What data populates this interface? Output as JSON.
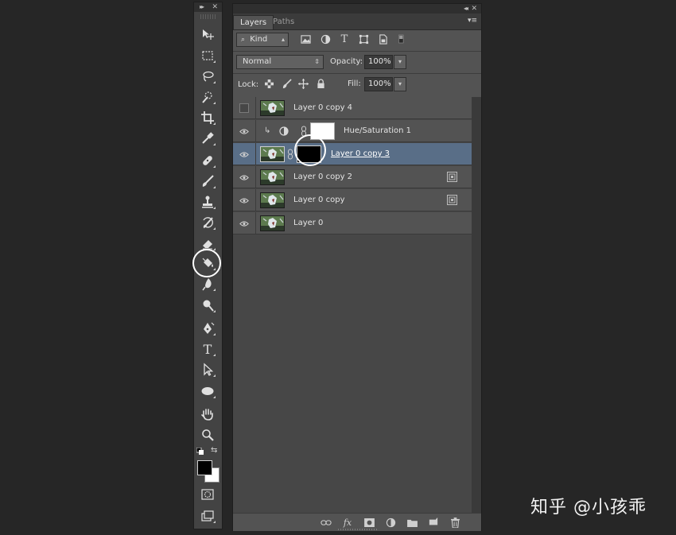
{
  "layers_panel": {
    "tabs": [
      {
        "label": "Layers"
      },
      {
        "label": "Paths"
      }
    ],
    "filter": {
      "kind_label": "Kind"
    },
    "blend_mode": "Normal",
    "opacity_label": "Opacity:",
    "opacity_value": "100%",
    "lock_label": "Lock:",
    "fill_label": "Fill:",
    "fill_value": "100%",
    "layers": [
      {
        "name": "Layer 0 copy 4",
        "visible": false,
        "selected": false
      },
      {
        "name": "Hue/Saturation 1",
        "visible": true,
        "selected": false,
        "adjustment": true,
        "clipped": true,
        "mask_color": "#ffffff"
      },
      {
        "name": "Layer 0 copy 3",
        "visible": true,
        "selected": true,
        "mask_color": "#000000"
      },
      {
        "name": "Layer 0 copy 2",
        "visible": true,
        "selected": false,
        "smart_object": true
      },
      {
        "name": "Layer 0 copy",
        "visible": true,
        "selected": false,
        "smart_object": true
      },
      {
        "name": "Layer 0",
        "visible": true,
        "selected": false
      }
    ],
    "bottom_icons": [
      "link-icon",
      "fx-icon",
      "add-mask-icon",
      "adjustment-icon",
      "folder-icon",
      "new-layer-icon",
      "trash-icon"
    ],
    "fx_label": "fx"
  },
  "toolbar": {
    "highlighted_tool": "paint-bucket-tool",
    "foreground_color": "#000000",
    "background_color": "#ffffff",
    "type_tool_glyph": "T"
  },
  "colors": {
    "selection": "#596e87",
    "panel": "#535353",
    "background": "#262626"
  },
  "watermark": "知乎 @小孩乖"
}
